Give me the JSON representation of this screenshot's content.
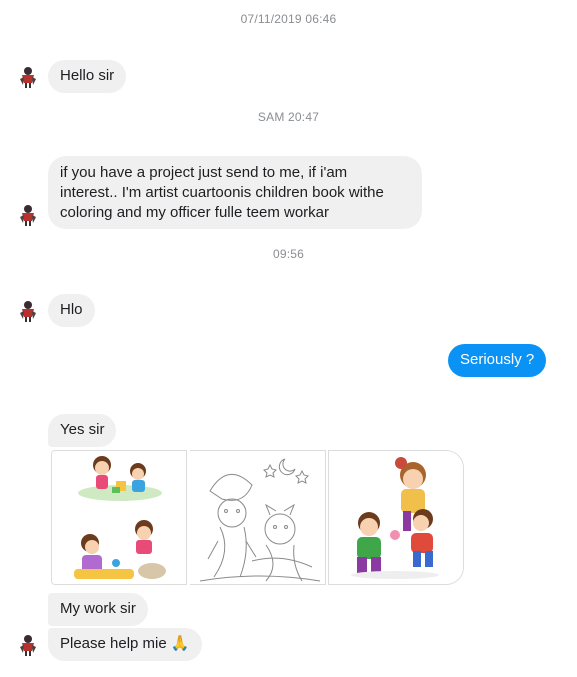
{
  "timestamps": {
    "t1": "07/11/2019 06:46",
    "t2": "SAM 20:47",
    "t3": "09:56"
  },
  "messages": {
    "m1": "Hello sir",
    "m2_line1": "if you have a project just send to me, if i'am",
    "m2_line2": "interest.. I'm artist cuartoonis children book withe",
    "m2_line3": "coloring and my officer fulle teem workar",
    "m3": "Hlo",
    "m4_outgoing": "Seriously ?",
    "m5": "Yes sir",
    "m6": "My work sir",
    "m7": "Please help mie 🙏"
  },
  "attachments": [
    {
      "icon": "kids-illustration-color"
    },
    {
      "icon": "kids-illustration-lineart"
    },
    {
      "icon": "kids-illustration-boys"
    }
  ],
  "colors": {
    "incoming_bubble": "#f0f0f0",
    "outgoing_bubble": "#0a92f5",
    "timestamp_text": "#8a8d91"
  }
}
